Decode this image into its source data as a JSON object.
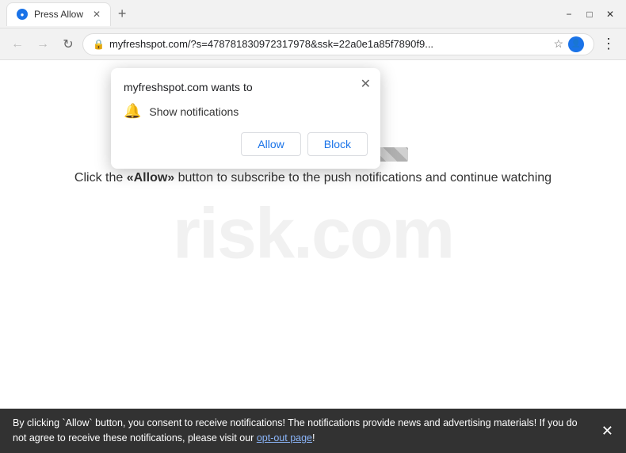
{
  "titlebar": {
    "tab_title": "Press Allow",
    "new_tab_label": "+",
    "controls": {
      "minimize": "−",
      "maximize": "□",
      "close": "✕"
    }
  },
  "addressbar": {
    "back_label": "←",
    "forward_label": "→",
    "reload_label": "↻",
    "url": "myfreshspot.com/?s=478781830972317978&ssk=22a0e1a85f7890f9...",
    "star_label": "☆",
    "menu_label": "⋮"
  },
  "popup": {
    "title": "myfreshspot.com wants to",
    "permission_label": "Show notifications",
    "allow_label": "Allow",
    "block_label": "Block",
    "close_label": "✕"
  },
  "page": {
    "progress_alt": "loading bar",
    "main_text": "Click the «Allow» button to subscribe to the push notifications and continue watching",
    "watermark": "risk.com"
  },
  "bottombar": {
    "message": "By clicking `Allow` button, you consent to receive notifications! The notifications provide news and advertising materials! If you do not agree to receive these notifications, please visit our ",
    "link_text": "opt-out page",
    "message_end": "!",
    "close_label": "✕"
  }
}
